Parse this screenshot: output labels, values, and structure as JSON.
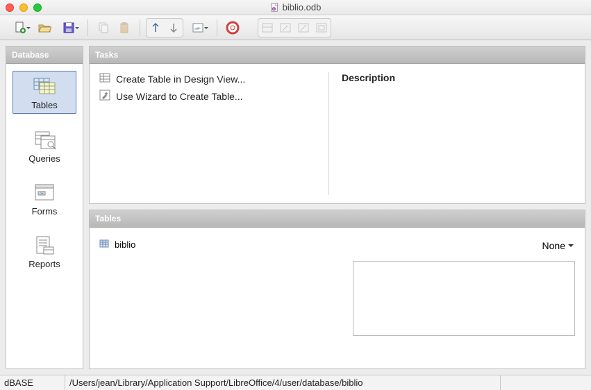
{
  "window": {
    "title": "biblio.odb"
  },
  "sidebar": {
    "header": "Database",
    "items": [
      {
        "label": "Tables"
      },
      {
        "label": "Queries"
      },
      {
        "label": "Forms"
      },
      {
        "label": "Reports"
      }
    ]
  },
  "tasks": {
    "header": "Tasks",
    "items": [
      {
        "label": "Create Table in Design View..."
      },
      {
        "label": "Use Wizard to Create Table..."
      }
    ],
    "description_heading": "Description"
  },
  "tables": {
    "header": "Tables",
    "items": [
      {
        "name": "biblio"
      }
    ],
    "preview_mode": "None"
  },
  "status": {
    "db_type": "dBASE",
    "path": "/Users/jean/Library/Application Support/LibreOffice/4/user/database/biblio"
  },
  "toolbar_icons": {
    "new": "new-doc",
    "open": "open-folder",
    "save": "save-disk",
    "copy": "copy",
    "paste": "paste",
    "sort_asc": "sort-asc",
    "sort_desc": "sort-desc",
    "form": "form",
    "help": "help-lifebuoy",
    "g1": "i1",
    "g2": "i2",
    "g3": "i3",
    "g4": "i4"
  }
}
